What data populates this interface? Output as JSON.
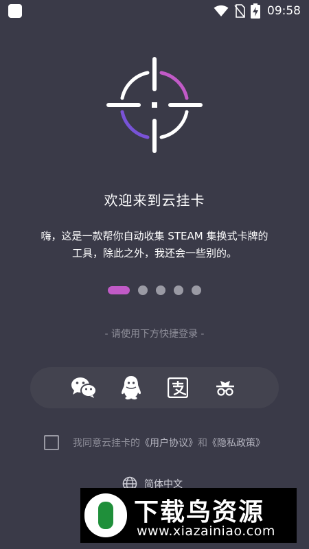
{
  "status_bar": {
    "time": "09:58",
    "icons": [
      "app-square-icon",
      "wifi-icon",
      "no-sim-icon",
      "battery-charging-icon"
    ]
  },
  "logo": {
    "icon": "crosshair-logo-icon",
    "accent_color": "#c15ac7",
    "secondary_color": "#6b55d8"
  },
  "welcome": {
    "title": "欢迎来到云挂卡",
    "intro_line1": "嗨，这是一款帮你自动收集 STEAM 集换式卡牌的",
    "intro_line2": "工具，除此之外，我还会一些别的。"
  },
  "pager": {
    "total": 5,
    "active_index": 0
  },
  "login": {
    "hint": "- 请使用下方快捷登录 -",
    "options": [
      {
        "name": "wechat",
        "icon": "wechat-icon"
      },
      {
        "name": "qq",
        "icon": "qq-icon"
      },
      {
        "name": "alipay",
        "icon": "alipay-icon"
      },
      {
        "name": "incognito",
        "icon": "incognito-icon"
      }
    ]
  },
  "agreement": {
    "checked": false,
    "prefix": "我同意云挂卡的",
    "user_agreement": "《用户协议》",
    "and": "和",
    "privacy_policy": "《隐私政策》"
  },
  "language": {
    "icon": "globe-icon",
    "label": "简体中文"
  },
  "watermark": {
    "title": "下载鸟资源",
    "url": "www.xiazainiao.com"
  }
}
